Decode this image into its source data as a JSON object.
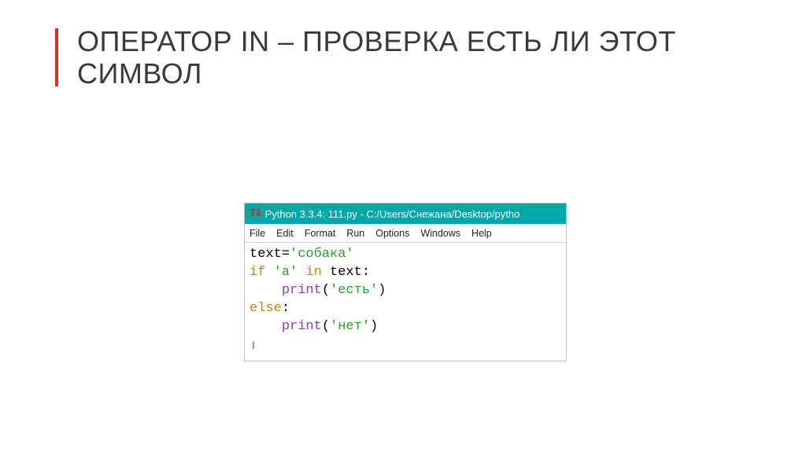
{
  "heading": "ОПЕРАТОР IN – ПРОВЕРКА ЕСТЬ ЛИ ЭТОТ СИМВОЛ",
  "editor": {
    "icon": "Tk",
    "title": "Python 3.3.4: 111.py - C:/Users/Снежана/Desktop/pytho",
    "menu": {
      "file": "File",
      "edit": "Edit",
      "format": "Format",
      "run": "Run",
      "options": "Options",
      "windows": "Windows",
      "help": "Help"
    },
    "code": {
      "line1_var": "text=",
      "line1_str": "'собака'",
      "line2_kw_if": "if",
      "line2_str": "'а'",
      "line2_kw_in": "in",
      "line2_rest": " text:",
      "line3_indent": "    ",
      "line3_print": "print",
      "line3_open": "(",
      "line3_str": "'есть'",
      "line3_close": ")",
      "line4_kw": "else",
      "line4_colon": ":",
      "line5_indent": "    ",
      "line5_print": "print",
      "line5_open": "(",
      "line5_str": "'нет'",
      "line5_close": ")"
    }
  }
}
